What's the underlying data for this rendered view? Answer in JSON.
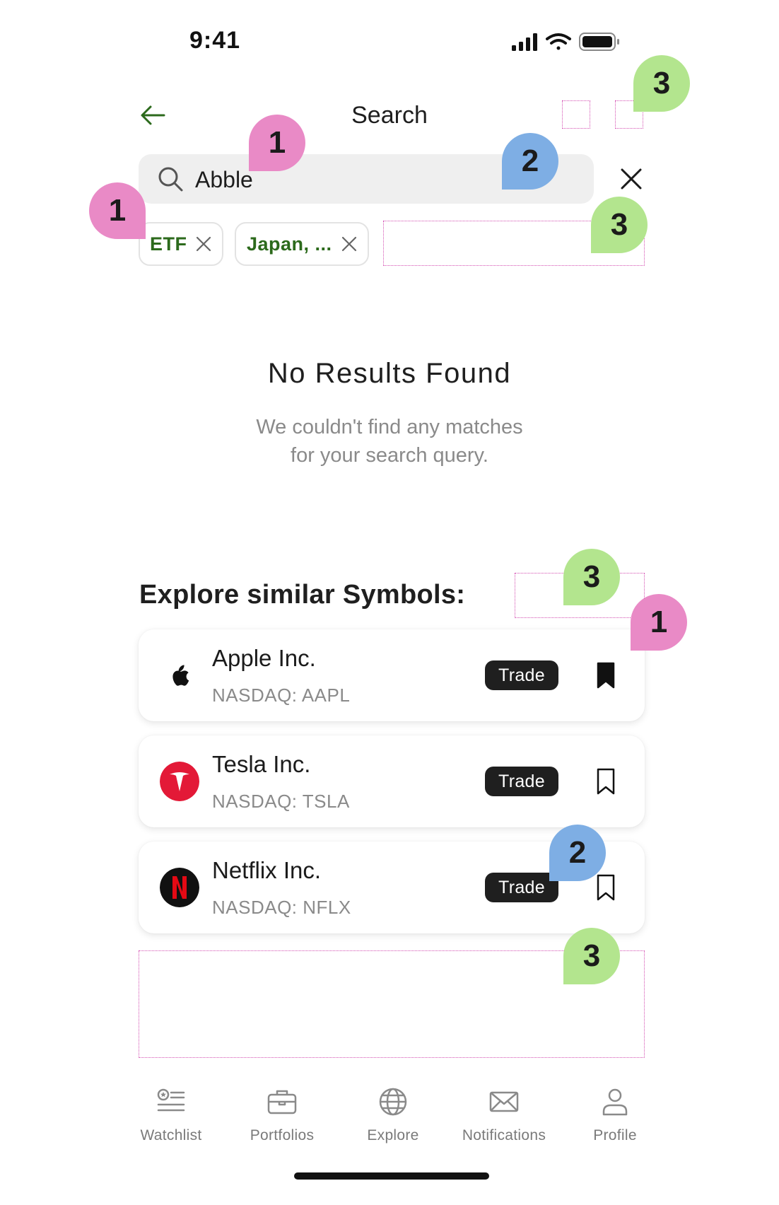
{
  "status_bar": {
    "time": "9:41"
  },
  "header": {
    "title": "Search"
  },
  "search": {
    "value": "Abble"
  },
  "filters": [
    {
      "label": "ETF"
    },
    {
      "label": "Japan, ..."
    }
  ],
  "empty_state": {
    "title": "No Results Found",
    "line1": "We couldn't find any matches",
    "line2": "for your search query."
  },
  "explore": {
    "title": "Explore similar Symbols:",
    "items": [
      {
        "name": "Apple Inc.",
        "ticker": "NASDAQ: AAPL",
        "trade_label": "Trade",
        "bookmarked": true,
        "logo_icon": "apple-logo-icon"
      },
      {
        "name": "Tesla Inc.",
        "ticker": "NASDAQ: TSLA",
        "trade_label": "Trade",
        "bookmarked": false,
        "logo_icon": "tesla-logo-icon"
      },
      {
        "name": "Netflix Inc.",
        "ticker": "NASDAQ: NFLX",
        "trade_label": "Trade",
        "bookmarked": false,
        "logo_icon": "netflix-logo-icon"
      }
    ]
  },
  "annotations": {
    "m1": "1",
    "m2": "2",
    "m3": "3"
  },
  "tabs": [
    {
      "label": "Watchlist",
      "icon": "watchlist-icon"
    },
    {
      "label": "Portfolios",
      "icon": "briefcase-icon"
    },
    {
      "label": "Explore",
      "icon": "globe-icon"
    },
    {
      "label": "Notifications",
      "icon": "mail-icon"
    },
    {
      "label": "Profile",
      "icon": "person-icon"
    }
  ],
  "colors": {
    "accent_green": "#2c6a1c",
    "marker_pink": "#e98ac6",
    "marker_blue": "#7eaee4",
    "marker_green": "#b3e58e",
    "tesla_red": "#e31937",
    "netflix_red": "#e50914"
  }
}
